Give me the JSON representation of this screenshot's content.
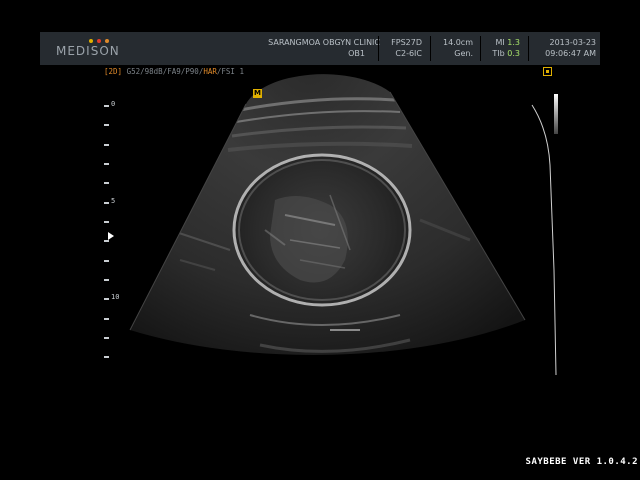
{
  "header": {
    "brand": "MEDISON",
    "clinic": "SARANGMOA OBGYN CLINIC",
    "preset": "OB1",
    "fps": "FPS27D",
    "probe": "C2-6IC",
    "depth": "14.0cm",
    "freq_mode": "Gen.",
    "mi_label": "MI",
    "mi_value": "1.3",
    "tib_label": "TIb",
    "tib_value": "0.3",
    "date": "2013-03-23",
    "time": "09:06:47 AM"
  },
  "params": {
    "mode": "[2D]",
    "settings": " G52/98dB/FA9/P90/",
    "harmonic": "HAR",
    "fsi": "/FSI 1"
  },
  "marker": {
    "label": "M"
  },
  "depth_scale": {
    "labels": [
      "0",
      "5",
      "10"
    ]
  },
  "footer": {
    "version": "SAYBEBE VER 1.0.4.2"
  },
  "colors": {
    "accent_orange": "#e08a2a",
    "value_green": "#a6e06a",
    "marker_yellow": "#e0b000",
    "header_bg": "#262b30"
  }
}
